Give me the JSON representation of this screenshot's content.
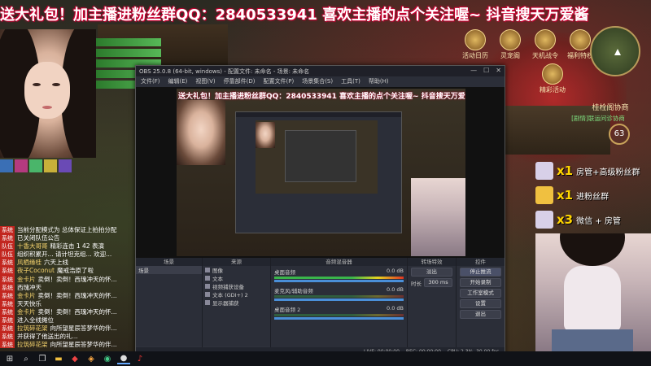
{
  "banner": {
    "text": "送大礼包！加主播进粉丝群QQ：2840533941 喜欢主播的点个关注喔~ 抖音搜天万爱酱"
  },
  "hud": {
    "top_icons": [
      "活动日历",
      "灵宠阁",
      "天机战令",
      "福利特权"
    ],
    "bottom_icon": "精彩活动",
    "quest_title": "桂栓阁协商",
    "quest_sub": "[剧情]联运问诊协商",
    "gauge": "63"
  },
  "gifts": [
    {
      "count": "x1",
      "text": "房管+高级粉丝群",
      "color": "#d8d0e8"
    },
    {
      "count": "x1",
      "text": "进粉丝群",
      "color": "#f0c040"
    },
    {
      "count": "x3",
      "text": "微信 + 房管",
      "color": "#d8d0e8"
    }
  ],
  "chat": [
    {
      "badge": "系统",
      "user": "",
      "msg": "当前分配模式为 总体保证上拍拍分配"
    },
    {
      "badge": "系统",
      "user": "",
      "msg": "已关闭队伍公告"
    },
    {
      "badge": "队伍",
      "user": "十香大哥哥",
      "msg": "精彩连击 1 42 表演"
    },
    {
      "badge": "队伍",
      "user": "",
      "msg": "组织积累开... 请计坦克组... 欢迎..."
    },
    {
      "badge": "系统",
      "user": "风栖缘桂",
      "msg": "六天上线"
    },
    {
      "badge": "系统",
      "user": "夜子Coconut",
      "msg": "魔戒浩原了啦"
    },
    {
      "badge": "系统",
      "user": "金卡片",
      "msg": "卖倒！卖倒！西瑰冲天的怀..."
    },
    {
      "badge": "系统",
      "user": "",
      "msg": "西瑰冲天"
    },
    {
      "badge": "系统",
      "user": "金卡片",
      "msg": "卖倒！卖倒！西瑰冲天的怀..."
    },
    {
      "badge": "系统",
      "user": "",
      "msg": "天天快乐"
    },
    {
      "badge": "系统",
      "user": "金卡片",
      "msg": "卖倒！卖倒！西瑰冲天的怀..."
    },
    {
      "badge": "系统",
      "user": "",
      "msg": "进入全线摊位"
    },
    {
      "badge": "系统",
      "user": "拉筑碎花架",
      "msg": "向所望星辰答梦华的伴..."
    },
    {
      "badge": "系统",
      "user": "",
      "msg": "并获得了他送出的礼..."
    },
    {
      "badge": "系统",
      "user": "拉筑碎花架",
      "msg": "向所望星辰答梦华的伴..."
    }
  ],
  "obs": {
    "title": "OBS 25.0.8 (64-bit, windows) - 配置文件: 未命名 - 场景: 未命名",
    "menu": [
      "文件(F)",
      "编辑(E)",
      "视图(V)",
      "停靠部件(D)",
      "配置文件(P)",
      "场景集合(S)",
      "工具(T)",
      "帮助(H)"
    ],
    "docks": {
      "scenes": {
        "title": "场景",
        "items": [
          "场景"
        ]
      },
      "sources": {
        "title": "来源",
        "items": [
          "图像",
          "文本",
          "视频捕获设备",
          "文本 (GDI+) 2",
          "显示器捕获"
        ]
      },
      "mixer": {
        "title": "音频混音器",
        "channels": [
          {
            "name": "桌面音频",
            "value": "0.0 dB"
          },
          {
            "name": "麦克风/辅助音频",
            "value": "0.0 dB"
          },
          {
            "name": "桌面音频 2",
            "value": "0.0 dB"
          }
        ]
      },
      "transitions": {
        "title": "转场特效",
        "mode": "淡出",
        "duration_label": "时长",
        "duration": "300 ms"
      },
      "controls": {
        "title": "控件",
        "buttons": [
          "停止推流",
          "开始录制",
          "工作室模式",
          "设置",
          "退出"
        ]
      }
    },
    "status": {
      "live": "LIVE: 00:00:00",
      "rec": "REC: 00:00:00",
      "cpu": "CPU: 2.3%, 30.00 fps"
    }
  },
  "taskbar": {
    "items": [
      "windows-start",
      "search",
      "task-view",
      "explorer",
      "game-a",
      "game-b",
      "chrome",
      "obs",
      "music"
    ]
  },
  "colors": {
    "banner_outline": "#cc0033",
    "gift_yellow": "#ffd400",
    "obs_bg": "#2b2e38",
    "chat_badge": "#c2261f"
  }
}
